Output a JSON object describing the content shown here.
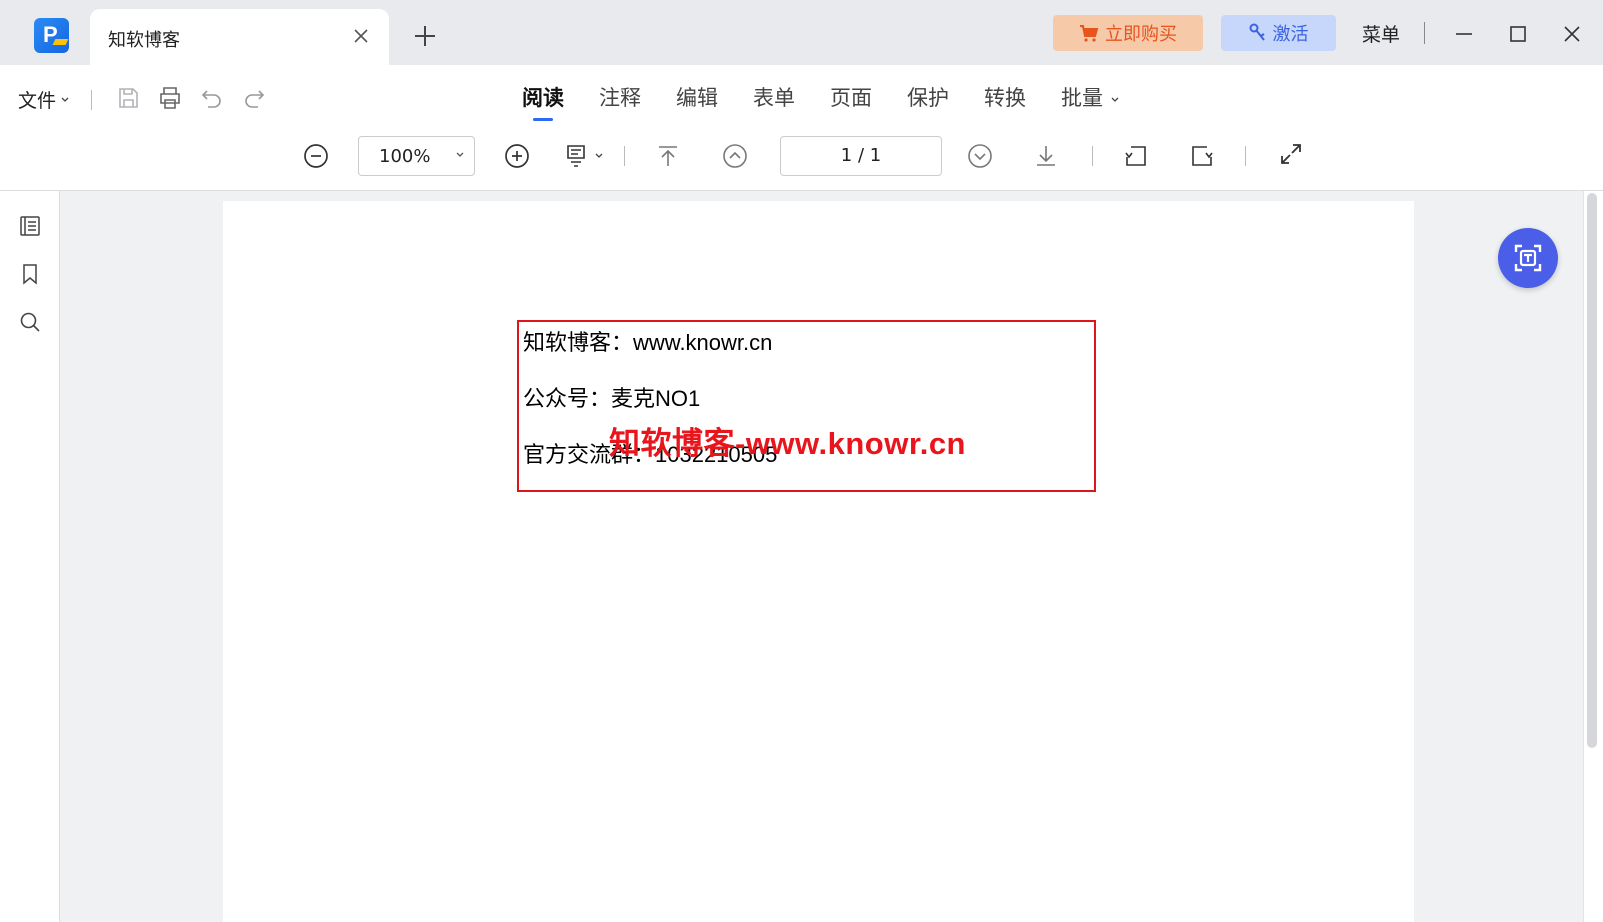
{
  "titlebar": {
    "tab_title": "知软博客",
    "buy_label": "立即购买",
    "activate_label": "激活",
    "menu_label": "菜单"
  },
  "toolbar": {
    "file_label": "文件",
    "tabs": [
      "阅读",
      "注释",
      "编辑",
      "表单",
      "页面",
      "保护",
      "转换",
      "批量"
    ],
    "active_tab": "阅读",
    "zoom_value": "100%",
    "page_indicator": "1 / 1"
  },
  "document": {
    "lines": [
      "知软博客：www.knowr.cn",
      "公众号：麦克NO1",
      "官方交流群：1032210505"
    ],
    "watermark": "知软博客-www.knowr.cn"
  },
  "colors": {
    "accent": "#2f6af2",
    "buy_bg": "#f6c9a9",
    "buy_text": "#e8541d",
    "activate_bg": "#c7d6fb",
    "activate_text": "#3a63e0",
    "highlight_border": "#e0151b",
    "ocr_button": "#4a5ee8"
  },
  "icons": {
    "sidebar": [
      "outline-icon",
      "bookmark-icon",
      "search-icon"
    ],
    "ocr": "ocr-text-icon"
  }
}
